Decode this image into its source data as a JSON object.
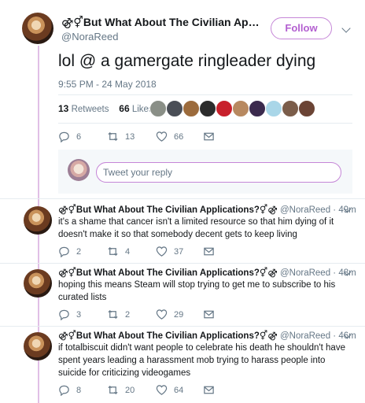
{
  "main_tweet": {
    "display_name": "⚣⚥But What About The Civilian Applications?⚥⚣",
    "handle": "@NoraReed",
    "follow_label": "Follow",
    "text": "lol @ a gamergate ringleader dying",
    "timestamp": "9:55 PM - 24 May 2018",
    "retweets_count": "13",
    "retweets_label": "Retweets",
    "likes_count": "66",
    "likes_label": "Likes",
    "actions": {
      "reply": "6",
      "retweet": "13",
      "like": "66"
    },
    "reply_placeholder": "Tweet your reply"
  },
  "replies": [
    {
      "name": "⚣⚥But What About The Civilian Applications?⚥⚣",
      "handle": "@NoraReed",
      "age": "· 49m",
      "text": "it's a shame that cancer isn't a limited resource so that him dying of it doesn't make it so that somebody decent gets to keep living",
      "reply": "2",
      "retweet": "4",
      "like": "37"
    },
    {
      "name": "⚣⚥But What About The Civilian Applications?⚥⚣",
      "handle": "@NoraReed",
      "age": "· 48m",
      "text": "hoping this means Steam will stop trying to get me to subscribe to his curated lists",
      "reply": "3",
      "retweet": "2",
      "like": "29"
    },
    {
      "name": "⚣⚥But What About The Civilian Applications?⚥⚣",
      "handle": "@NoraReed",
      "age": "· 46m",
      "text": "if totalbiscuit didn't want people to celebrate his death he shouldn't have spent years leading a harassment mob trying to harass people into suicide for criticizing videogames",
      "reply": "8",
      "retweet": "20",
      "like": "64"
    }
  ],
  "colors": {
    "accent": "#b35fd0",
    "thread_line": "#e1bfe6",
    "muted": "#657786"
  }
}
